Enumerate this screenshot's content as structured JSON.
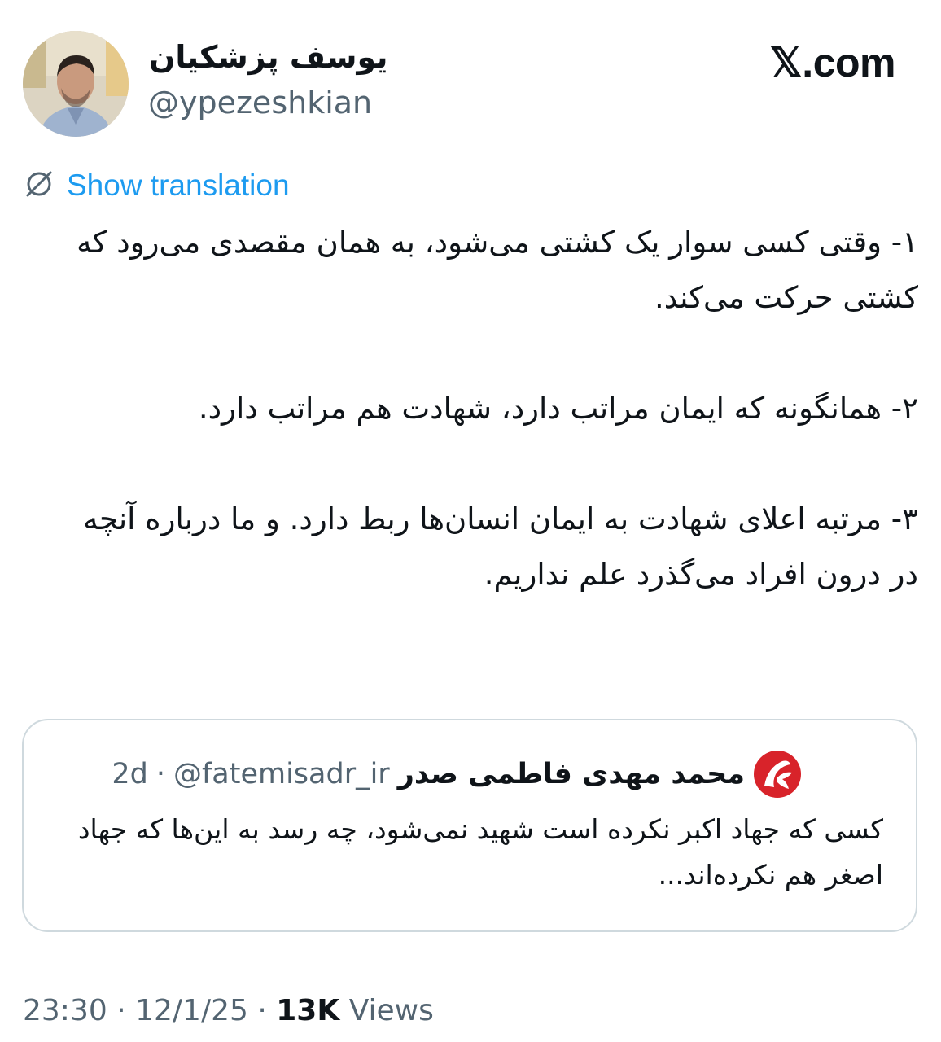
{
  "author": {
    "display_name": "یوسف پزشکیان",
    "handle": "@ypezeshkian"
  },
  "brand": {
    "label": "𝕏.com"
  },
  "translation": {
    "icon": "globe-slash-icon",
    "label": "Show translation"
  },
  "tweet": {
    "paragraphs": [
      "۱- وقتی کسی سوار یک کشتی می‌شود، به همان مقصدی می‌رود که کشتی حرکت می‌کند.",
      "۲- همانگونه که ایمان مراتب دارد، شهادت هم مراتب دارد.",
      "۳- مرتبه اعلای شهادت به ایمان انسان‌ها ربط دارد. و ما درباره آنچه در درون افراد می‌گذرد علم نداریم."
    ]
  },
  "quoted_tweet": {
    "logo_icon": "red-circle-logo-icon",
    "display_name": "محمد مهدی فاطمی صدر",
    "handle": "@fatemisadr_ir",
    "separator": "·",
    "time": "2d",
    "text": "کسی که جهاد اکبر نکرده است شهید نمی‌شود، چه رسد به این‌ها که جهاد اصغر هم نکرده‌اند..."
  },
  "meta": {
    "time": "23:30",
    "separator": "·",
    "date": "12/1/25",
    "views_count": "13K",
    "views_label": "Views"
  },
  "colors": {
    "link": "#1d9bf0",
    "secondary_text": "#536471",
    "primary_text": "#0f1419",
    "card_border": "#cfd9de",
    "quote_logo_red": "#d8232a"
  }
}
